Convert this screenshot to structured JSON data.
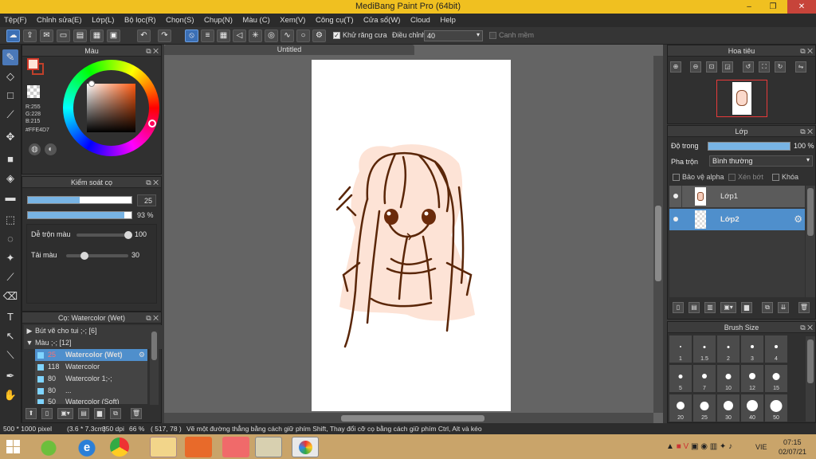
{
  "title": "MediBang Paint Pro (64bit)",
  "window_controls": {
    "minimize": "–",
    "maximize": "❐",
    "close": "✕"
  },
  "menu": [
    "Tệp(F)",
    "Chỉnh sửa(E)",
    "Lớp(L)",
    "Bộ lọc(R)",
    "Chọn(S)",
    "Chụp(N)",
    "Màu (C)",
    "Xem(V)",
    "Công cụ(T)",
    "Cửa sổ(W)",
    "Cloud",
    "Help"
  ],
  "toolbar": {
    "antialias_label": "Khử răng cưa",
    "correction_label": "Điều chỉnh",
    "correction_value": "40",
    "snap_label": "Canh mềm"
  },
  "color_panel": {
    "title": "Màu",
    "r": "R:255",
    "g": "G:228",
    "b": "B:215",
    "hex": "#FFE4D7",
    "primary": "#FFE4D7",
    "secondary": "#c0402a"
  },
  "brush_control": {
    "title": "Kiểm soát cọ",
    "size": "25",
    "opacity": "93 %",
    "blend_label": "Dễ trộn màu",
    "blend_value": "100",
    "load_label": "Tải màu",
    "load_value": "30",
    "size_fraction": 0.5,
    "opacity_fraction": 0.93,
    "blend_fraction": 1.0,
    "load_fraction": 0.3
  },
  "brush_list": {
    "title": "Cọ: Watercolor (Wet)",
    "groups": [
      {
        "label": "Bút vẽ cho tui ;-; [6]",
        "expanded": false
      },
      {
        "label": "Màu ;-; [12]",
        "expanded": true
      }
    ],
    "items": [
      {
        "size": "25",
        "name": "Watercolor (Wet)",
        "selected": true
      },
      {
        "size": "118",
        "name": "Watercolor",
        "selected": false
      },
      {
        "size": "80",
        "name": "Watercolor 1;-;",
        "selected": false
      },
      {
        "size": "80",
        "name": "...",
        "selected": false
      },
      {
        "size": "50",
        "name": "Watercolor (Soft)",
        "selected": false
      }
    ]
  },
  "canvas": {
    "tab_title": "Untitled"
  },
  "navigator": {
    "title": "Hoa tiêu"
  },
  "layers": {
    "title": "Lớp",
    "opacity_label": "Độ trong",
    "opacity_value": "100 %",
    "blend_label": "Pha trộn",
    "blend_value": "Bình thường",
    "protect_alpha": "Bảo vệ alpha",
    "clipping": "Xén bớt",
    "lock": "Khóa",
    "items": [
      {
        "name": "Lớp1",
        "selected": false
      },
      {
        "name": "Lớp2",
        "selected": true
      }
    ]
  },
  "brush_size": {
    "title": "Brush Size",
    "sizes": [
      "1",
      "1.5",
      "2",
      "3",
      "4",
      "5",
      "7",
      "10",
      "12",
      "15",
      "20",
      "25",
      "30",
      "40",
      "50"
    ]
  },
  "status": {
    "size": "500 * 1000 pixel",
    "physical": "(3.6 * 7.3cm)",
    "dpi": "350 dpi",
    "zoom": "66 %",
    "cursor": "( 517, 78 )",
    "hint": "Vẽ một đường thẳng bằng cách giữ phím Shift, Thay đổi cỡ cọ bằng cách giữ phím Ctrl, Alt và kéo"
  },
  "taskbar": {
    "lang": "VIE",
    "time": "07:15",
    "date": "02/07/21"
  }
}
